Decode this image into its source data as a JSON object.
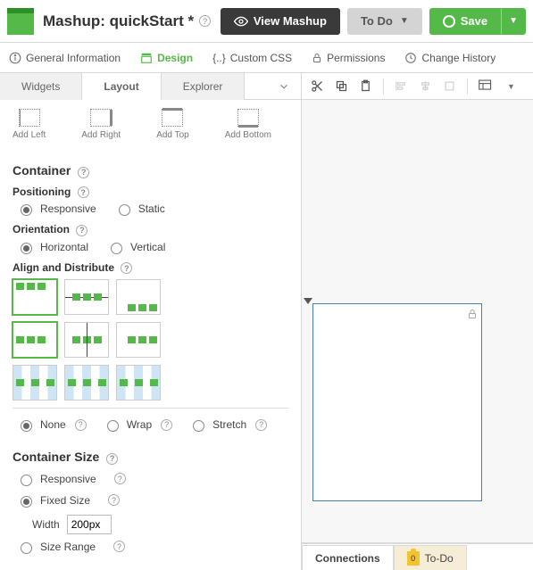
{
  "header": {
    "title": "Mashup: quickStart *",
    "view_btn": "View Mashup",
    "todo_btn": "To Do",
    "save_btn": "Save"
  },
  "entity_tabs": {
    "general": "General Information",
    "design": "Design",
    "custom_css": "Custom CSS",
    "permissions": "Permissions",
    "history": "Change History"
  },
  "side_tabs": {
    "widgets": "Widgets",
    "layout": "Layout",
    "explorer": "Explorer"
  },
  "add_panel": {
    "left": "Add Left",
    "right": "Add Right",
    "top": "Add Top",
    "bottom": "Add Bottom"
  },
  "container": {
    "heading": "Container",
    "positioning_lbl": "Positioning",
    "responsive": "Responsive",
    "static": "Static",
    "orientation_lbl": "Orientation",
    "horizontal": "Horizontal",
    "vertical": "Vertical",
    "align_lbl": "Align and Distribute",
    "none": "None",
    "wrap": "Wrap",
    "stretch": "Stretch"
  },
  "size": {
    "heading": "Container Size",
    "responsive": "Responsive",
    "fixed": "Fixed Size",
    "width_lbl": "Width",
    "width_val": "200px",
    "range": "Size Range"
  },
  "bottom_tabs": {
    "connections": "Connections",
    "todo": "To-Do",
    "todo_count": "0"
  }
}
